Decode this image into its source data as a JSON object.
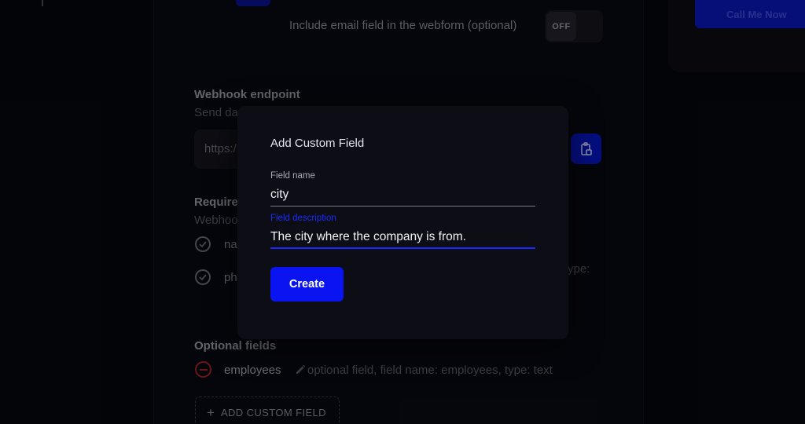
{
  "form": {
    "email_toggle_label": "Include email field in the webform (optional)",
    "email_toggle_state": "OFF",
    "call_button_label": "Call Me Now"
  },
  "webhook": {
    "title": "Webhook endpoint",
    "subtitle_partial": "Send da",
    "url_partial": "https:/"
  },
  "required": {
    "title_partial": "Require",
    "subtitle_partial": "Webhoo",
    "items": [
      {
        "name_partial": "na"
      },
      {
        "name_partial": "ph"
      }
    ],
    "type_partial": "ype:"
  },
  "optional": {
    "title": "Optional fields",
    "items": [
      {
        "name": "employees",
        "description": "optional field, field name: employees, type: text"
      }
    ],
    "add_button_label": "ADD CUSTOM FIELD"
  },
  "modal": {
    "title": "Add Custom Field",
    "field_name_label": "Field name",
    "field_name_value": "city",
    "field_description_label": "Field description",
    "field_description_value": "The city where the company is from.",
    "create_label": "Create"
  },
  "colors": {
    "accent": "#0a14f0",
    "danger": "#a02323",
    "focus": "#1b2bff"
  },
  "icons": [
    "clipboard-icon",
    "check-circle-icon",
    "minus-circle-icon",
    "pencil-icon",
    "plus-icon"
  ]
}
